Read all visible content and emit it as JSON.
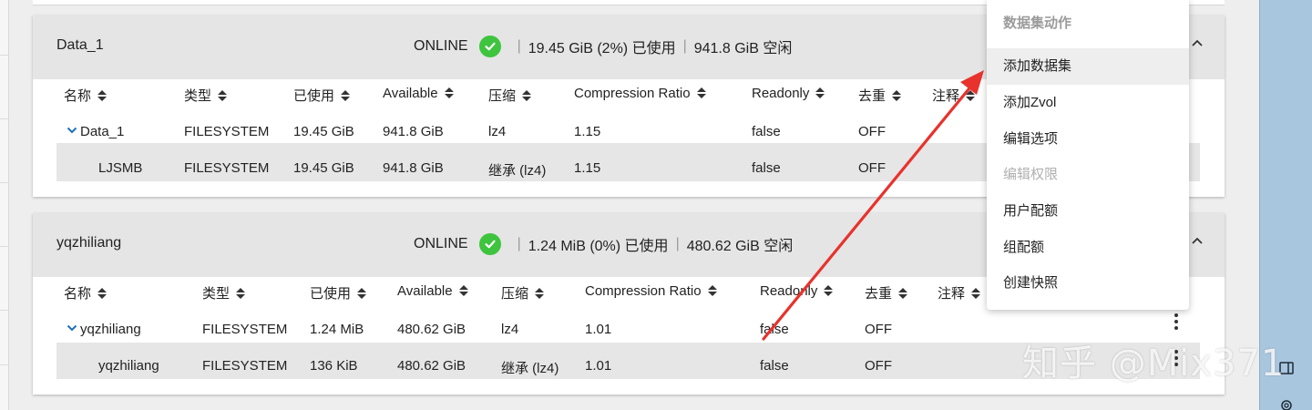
{
  "pools": [
    {
      "name": "Data_1",
      "status": "ONLINE",
      "used": "19.45 GiB (2%) 已使用",
      "free": "941.8 GiB 空闲",
      "columns": [
        "名称",
        "类型",
        "已使用",
        "Available",
        "压缩",
        "Compression Ratio",
        "Readonly",
        "去重",
        "注释"
      ],
      "rows": [
        {
          "name": "Data_1",
          "type": "FILESYSTEM",
          "used": "19.45 GiB",
          "available": "941.8 GiB",
          "compression": "lz4",
          "ratio": "1.15",
          "readonly": "false",
          "dedup": "OFF"
        },
        {
          "name": "LJSMB",
          "type": "FILESYSTEM",
          "used": "19.45 GiB",
          "available": "941.8 GiB",
          "compression": "继承 (lz4)",
          "ratio": "1.15",
          "readonly": "false",
          "dedup": "OFF"
        }
      ]
    },
    {
      "name": "yqzhiliang",
      "status": "ONLINE",
      "used": "1.24 MiB (0%) 已使用",
      "free": "480.62 GiB 空闲",
      "columns": [
        "名称",
        "类型",
        "已使用",
        "Available",
        "压缩",
        "Compression Ratio",
        "Readonly",
        "去重",
        "注释"
      ],
      "rows": [
        {
          "name": "yqzhiliang",
          "type": "FILESYSTEM",
          "used": "1.24 MiB",
          "available": "480.62 GiB",
          "compression": "lz4",
          "ratio": "1.01",
          "readonly": "false",
          "dedup": "OFF"
        },
        {
          "name": "yqzhiliang",
          "type": "FILESYSTEM",
          "used": "136 KiB",
          "available": "480.62 GiB",
          "compression": "继承 (lz4)",
          "ratio": "1.01",
          "readonly": "false",
          "dedup": "OFF"
        }
      ]
    }
  ],
  "menu": {
    "header": "数据集动作",
    "items": [
      "添加数据集",
      "添加Zvol",
      "编辑选项",
      "编辑权限",
      "用户配额",
      "组配额",
      "创建快照"
    ]
  },
  "watermark": "知乎 @Mix371",
  "colors": {
    "status_ok": "#3ec43e",
    "annotation_arrow": "#e8322c",
    "right_panel": "#a9c6df"
  },
  "icons": [
    "check-circle-icon",
    "sort-icon",
    "chevron-down-icon",
    "chevron-up-icon",
    "kebab-icon",
    "window-icon",
    "gear-icon"
  ]
}
